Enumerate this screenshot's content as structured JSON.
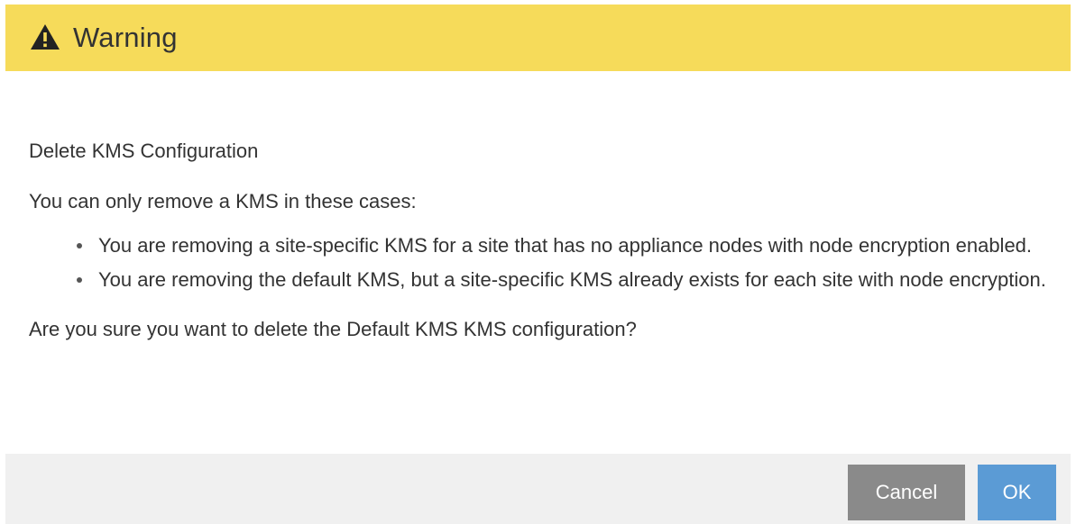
{
  "header": {
    "title": "Warning",
    "icon": "warning-triangle-icon",
    "background_color": "#f6db5a"
  },
  "body": {
    "heading": "Delete KMS Configuration",
    "intro": "You can only remove a KMS in these cases:",
    "cases": [
      "You are removing a site-specific KMS for a site that has no appliance nodes with node encryption enabled.",
      "You are removing the default KMS, but a site-specific KMS already exists for each site with node encryption."
    ],
    "question": "Are you sure you want to delete the Default KMS KMS configuration?"
  },
  "footer": {
    "cancel_label": "Cancel",
    "ok_label": "OK",
    "cancel_color": "#8a8a8a",
    "ok_color": "#5b9bd5"
  }
}
